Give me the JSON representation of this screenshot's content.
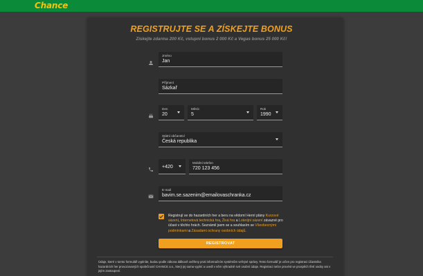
{
  "brand": {
    "logo": "Chance",
    "colors": {
      "header": "#0b8a3a",
      "accent": "#f0a01e",
      "logo": "#f2c40f"
    }
  },
  "page": {
    "title": "REGISTRUJTE SE A ZÍSKEJTE BONUS",
    "subtitle": "Získejte zdarma 200 Kč, vstupní bonus 2 000 Kč a Vegas bonus 25 000 Kč!"
  },
  "form": {
    "first_name": {
      "label": "Jméno",
      "value": "Jan"
    },
    "last_name": {
      "label": "Příjmení",
      "value": "Sázkař"
    },
    "birth_day": {
      "label": "Den",
      "value": "20"
    },
    "birth_month": {
      "label": "Měsíc",
      "value": "5"
    },
    "birth_year": {
      "label": "Rok",
      "value": "1990"
    },
    "citizenship": {
      "label": "Státní občanství",
      "value": "Česká republika"
    },
    "phone_prefix": {
      "value": "+420"
    },
    "phone": {
      "label": "Mobilní telefon",
      "value": "720 123 456"
    },
    "email": {
      "label": "E-mail",
      "value": "bavim.se.sazenim@emailovaschranka.cz"
    },
    "icons": [
      "person-icon",
      "cake-icon",
      "phone-icon",
      "email-icon"
    ],
    "consent": {
      "checked": true,
      "t1": "Registrují se do hazardních her a beru na vědomí Herní plány ",
      "l1": "Kurzové sázení",
      "t2": ", ",
      "l2": "Internetová technická hra",
      "t3": ", ",
      "l3": "Živá hra",
      "t4": " a ",
      "l4": "Loterijní sázení",
      "t5": " závazné pro účast v těchto hrách. Seznámil jsem se a souhlasím se ",
      "l5": "Všeobecnými podmínkami",
      "t6": " a ",
      "l6": "Zásadami ochrany osobních údajů",
      "t7": "."
    },
    "submit_label": "REGISTROVAT"
  },
  "footer": {
    "text": "Údaje, které v tomto formuláři vyplníte, budou podle zákona dálkově ověřeny proti informačním systémům veřejné správy. Tento formulář je určen pro registraci účastníka hazardních her provozovaných společností CHANCE a.s., který jej sama vyplní a uvedl v něm výhradně své osobní údaje. Registraci nelze provést ve prospěch třetí osoby ani v jejím zastoupení."
  }
}
